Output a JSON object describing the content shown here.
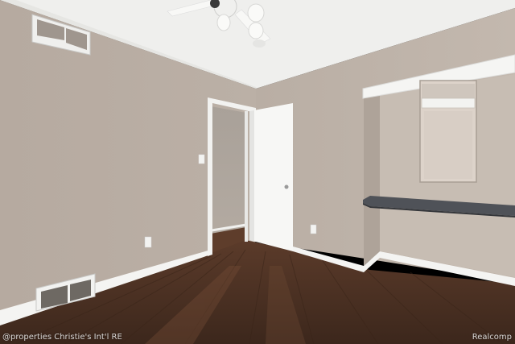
{
  "photo": {
    "scene": "empty-bedroom-interior",
    "colors": {
      "wall_left": "#b8aca2",
      "wall_right": "#bfb4aa",
      "ceiling": "#eeeeec",
      "floor": "#4a3124",
      "floor_light": "#6a4632",
      "trim": "#f4f4f2",
      "door": "#f6f6f4",
      "shelf": "#4f5258"
    }
  },
  "watermarks": {
    "left": "@properties Christie's Int'l RE",
    "right": "Realcomp"
  }
}
